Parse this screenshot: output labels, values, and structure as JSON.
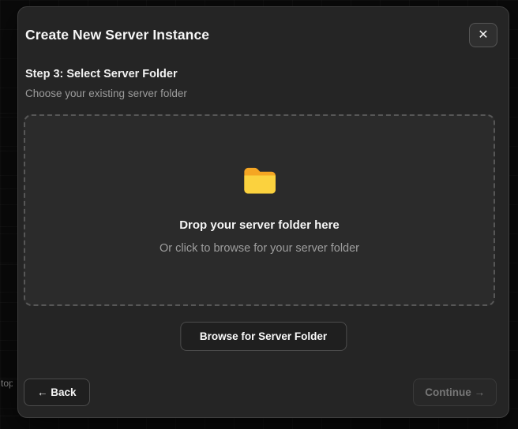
{
  "background": {
    "fragment_text": "top"
  },
  "modal": {
    "title": "Create New Server Instance",
    "close_icon": "✕",
    "step": {
      "heading": "Step 3: Select Server Folder",
      "subheading": "Choose your existing server folder"
    },
    "dropzone": {
      "icon": "folder-icon",
      "heading": "Drop your server folder here",
      "subheading": "Or click to browse for your server folder"
    },
    "browse_button_label": "Browse for Server Folder",
    "footer": {
      "back_button_label": "← Back",
      "continue_button_label": "Continue →",
      "continue_enabled": false
    }
  },
  "colors": {
    "backdrop": "#0a0a0a",
    "modal_background": "#252525",
    "modal_border": "#3e3e3e",
    "dropzone_background": "#2b2b2b",
    "dropzone_dashed_border": "#575757",
    "primary_text": "#f5f5f5",
    "secondary_text": "#9c9c9c",
    "disabled_text": "#777777",
    "folder_back": "#f5a623",
    "folder_front": "#fbd23e"
  }
}
